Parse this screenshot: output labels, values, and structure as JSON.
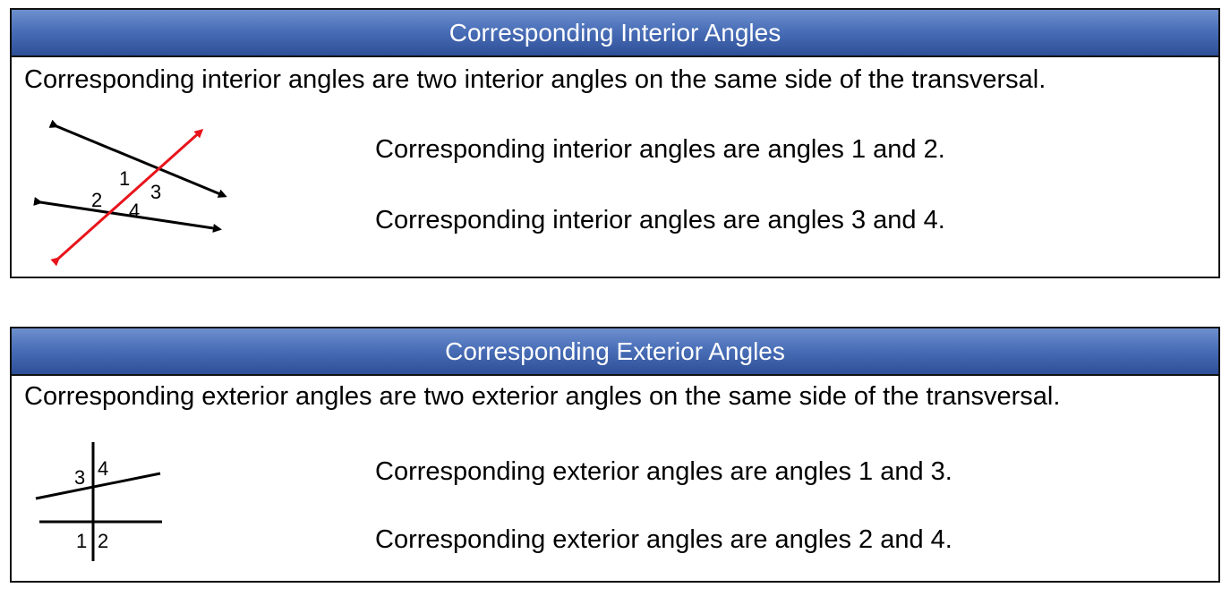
{
  "interior": {
    "title": "Corresponding Interior Angles",
    "definition": "Corresponding interior angles are two interior angles on the same side of the transversal.",
    "facts": [
      "Corresponding interior angles are angles 1 and 2.",
      "Corresponding interior angles are angles 3 and 4."
    ],
    "figure_labels": [
      "1",
      "2",
      "3",
      "4"
    ]
  },
  "exterior": {
    "title": "Corresponding Exterior Angles",
    "definition": "Corresponding exterior angles are two exterior angles on the same side of the transversal.",
    "facts": [
      "Corresponding exterior angles are angles 1 and 3.",
      "Corresponding exterior angles are angles 2 and 4."
    ],
    "figure_labels": [
      "1",
      "2",
      "3",
      "4"
    ]
  },
  "colors": {
    "header_top": "#6e90cf",
    "header_bottom": "#2e4f97",
    "transversal": "#e8141c",
    "lines": "#000000"
  }
}
